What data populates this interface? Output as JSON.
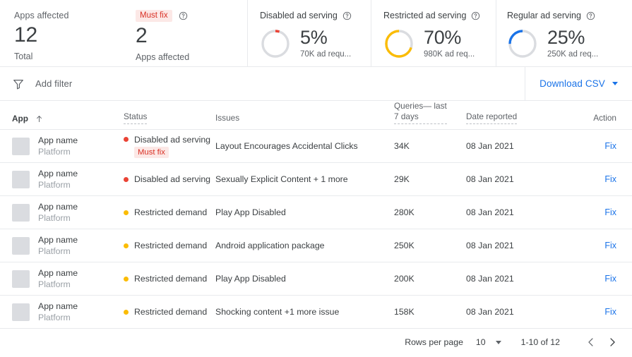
{
  "summary": {
    "cards": [
      {
        "type": "number",
        "label": "Apps affected",
        "value": "12",
        "sublabel": "Total"
      },
      {
        "type": "badge-number",
        "badge": "Must fix",
        "help_icon": "help-circle-icon",
        "value": "2",
        "sublabel": "Apps affected"
      }
    ],
    "donuts": [
      {
        "title": "Disabled ad serving",
        "help_icon": "help-circle-icon",
        "percent": "5%",
        "percent_value": 5,
        "sublabel": "70K ad requ...",
        "color": "#ea4335",
        "track_color": "#dadce0",
        "direction": "clockwise"
      },
      {
        "title": "Restricted ad serving",
        "help_icon": "help-circle-icon",
        "percent": "70%",
        "percent_value": 70,
        "sublabel": "980K ad req...",
        "color": "#fbbc04",
        "track_color": "#dadce0",
        "direction": "counter-clockwise"
      },
      {
        "title": "Regular ad serving",
        "help_icon": "help-circle-icon",
        "percent": "25%",
        "percent_value": 25,
        "sublabel": "250K ad req...",
        "color": "#1a73e8",
        "track_color": "#dadce0",
        "direction": "counter-clockwise"
      }
    ]
  },
  "filter_bar": {
    "filter_icon": "filter-funnel-icon",
    "placeholder": "Add filter",
    "download_label": "Download CSV",
    "download_caret": "chevron-down-icon"
  },
  "table": {
    "columns": [
      {
        "key": "app",
        "label": "App",
        "sort_icon": "arrow-up-icon",
        "sorted": true,
        "dotted": false
      },
      {
        "key": "status",
        "label": "Status",
        "dotted": true
      },
      {
        "key": "issues",
        "label": "Issues",
        "dotted": false
      },
      {
        "key": "queries",
        "label": "Queries— last 7 days",
        "line1": "Queries— last",
        "line2": "7 days",
        "dotted": true
      },
      {
        "key": "date",
        "label": "Date reported",
        "dotted": true
      },
      {
        "key": "action",
        "label": "Action",
        "dotted": false
      }
    ],
    "rows": [
      {
        "app_name": "App name",
        "platform": "Platform",
        "status": "Disabled ad serving",
        "status_color": "#ea4335",
        "status_badge": "Must fix",
        "issues": "Layout Encourages Accidental Clicks",
        "queries": "34K",
        "date": "08 Jan 2021",
        "action": "Fix"
      },
      {
        "app_name": "App name",
        "platform": "Platform",
        "status": "Disabled ad serving",
        "status_color": "#ea4335",
        "status_badge": "",
        "issues": "Sexually Explicit Content + 1 more",
        "queries": "29K",
        "date": "08 Jan 2021",
        "action": "Fix"
      },
      {
        "app_name": "App name",
        "platform": "Platform",
        "status": "Restricted demand",
        "status_color": "#fbbc04",
        "status_badge": "",
        "issues": "Play App Disabled",
        "queries": "280K",
        "date": "08 Jan 2021",
        "action": "Fix"
      },
      {
        "app_name": "App name",
        "platform": "Platform",
        "status": "Restricted demand",
        "status_color": "#fbbc04",
        "status_badge": "",
        "issues": "Android application package",
        "queries": "250K",
        "date": "08 Jan 2021",
        "action": "Fix"
      },
      {
        "app_name": "App name",
        "platform": "Platform",
        "status": "Restricted demand",
        "status_color": "#fbbc04",
        "status_badge": "",
        "issues": "Play App Disabled",
        "queries": "200K",
        "date": "08 Jan 2021",
        "action": "Fix"
      },
      {
        "app_name": "App name",
        "platform": "Platform",
        "status": "Restricted demand",
        "status_color": "#fbbc04",
        "status_badge": "",
        "issues": "Shocking content +1 more issue",
        "queries": "158K",
        "date": "08 Jan 2021",
        "action": "Fix"
      }
    ]
  },
  "pagination": {
    "rows_per_page_label": "Rows per page",
    "rows_per_page_value": "10",
    "caret_icon": "chevron-down-icon",
    "range": "1-10 of 12",
    "prev_icon": "chevron-left-icon",
    "next_icon": "chevron-right-icon"
  },
  "colors": {
    "accent_blue": "#1a73e8",
    "red": "#ea4335",
    "yellow": "#fbbc04",
    "border": "#e8eaed",
    "text_primary": "#3c4043",
    "text_secondary": "#5f6368"
  }
}
